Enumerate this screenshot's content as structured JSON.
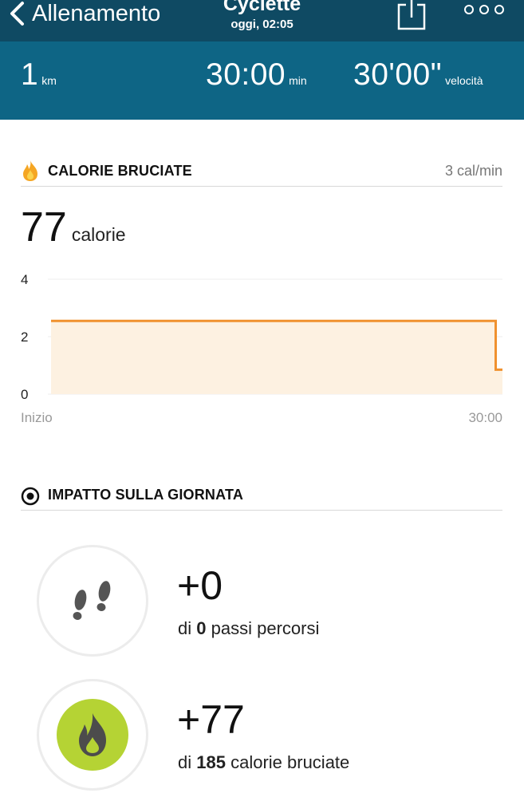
{
  "header": {
    "back_label": "Allenamento",
    "title": "Cyclette",
    "subtitle": "oggi, 02:05",
    "background": "#0f4a63"
  },
  "stats": {
    "distance_value": "1",
    "distance_unit": "km",
    "duration_value": "30:00",
    "duration_unit": "min",
    "pace_value": "30'00\"",
    "pace_unit": "velocità",
    "background": "#0e6585"
  },
  "calories_section": {
    "heading": "CALORIE BRUCIATE",
    "rate": "3 cal/min",
    "total_value": "77",
    "total_unit": "calorie",
    "accent": "#f0912e"
  },
  "chart_data": {
    "type": "area",
    "x_tick_labels": [
      "Inizio",
      "30:00"
    ],
    "y_ticks": [
      "0",
      "2",
      "4"
    ],
    "ylim": [
      0,
      4
    ],
    "x": [
      0,
      0.985,
      0.985,
      1
    ],
    "y": [
      2.55,
      2.55,
      0.85,
      0.85
    ],
    "line_color": "#f0912e",
    "fill_color": "#fdf1e1",
    "grid": true
  },
  "impact_section": {
    "heading": "IMPATTO SULLA GIORNATA",
    "steps": {
      "delta": "+0",
      "prefix": "di",
      "total": "0",
      "suffix": "passi percorsi",
      "icon": "footsteps-icon"
    },
    "calories": {
      "delta": "+77",
      "prefix": "di",
      "total": "185",
      "suffix": "calorie bruciate",
      "icon": "flame-icon",
      "badge_color": "#b5d334"
    }
  }
}
